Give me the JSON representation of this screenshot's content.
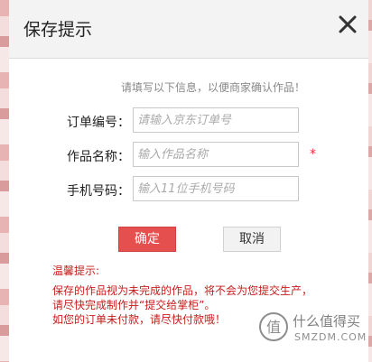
{
  "dialog": {
    "title": "保存提示",
    "close_icon": "close-icon",
    "info_tip": "请填写以下信息，以便商家确认作品！",
    "fields": [
      {
        "label": "订单编号：",
        "placeholder": "请输入京东订单号",
        "value": ""
      },
      {
        "label": "作品名称：",
        "placeholder": "输入作品名称",
        "value": "",
        "required_mark": "*"
      },
      {
        "label": "手机号码：",
        "placeholder": "输入11位手机号码",
        "value": ""
      }
    ],
    "buttons": {
      "confirm": "确定",
      "cancel": "取消"
    },
    "warm_tip": {
      "heading": "温馨提示:",
      "lines": [
        "保存的作品视为未完成的作品，将不会为您提交生产，",
        "请尽快完成制作并“提交给掌柜”。",
        "如您的订单未付款，请尽快付款哦！"
      ]
    }
  },
  "watermark": {
    "text": "什么值得买",
    "sub": "SMZDM.COM"
  },
  "colors": {
    "confirm_bg": "#e5504e",
    "tip_red": "#c81c1c",
    "header_bg": "#f3f3f3"
  }
}
